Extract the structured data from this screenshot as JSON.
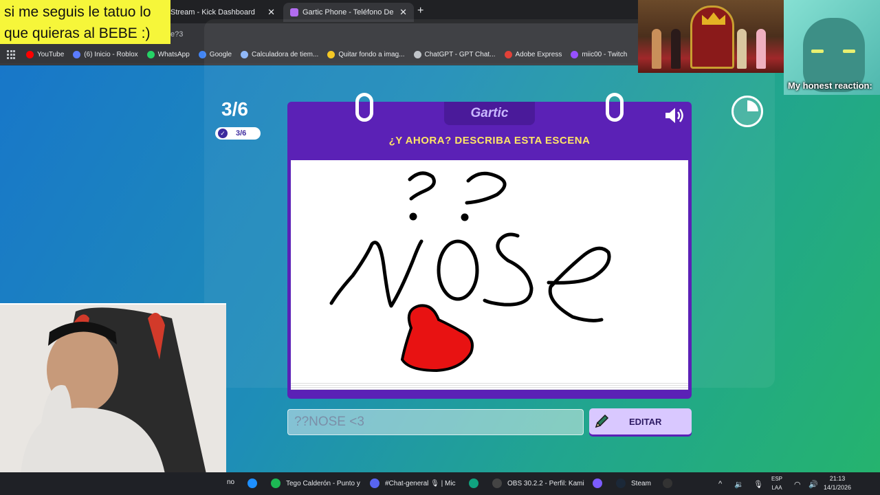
{
  "browser": {
    "tabs": [
      {
        "title": "Stream - Kick Dashboard",
        "active": false
      },
      {
        "title": "Gartic Phone - Teléfono Descon",
        "active": true
      }
    ],
    "address_fragment": "e?3",
    "bookmarks": [
      {
        "label": "YouTube",
        "icon": "youtube-icon",
        "color": "#ff0000"
      },
      {
        "label": "(6) Inicio - Roblox",
        "icon": "roblox-icon",
        "color": "#5b7cff"
      },
      {
        "label": "WhatsApp",
        "icon": "whatsapp-icon",
        "color": "#25d366"
      },
      {
        "label": "Google",
        "icon": "google-icon",
        "color": "#4285f4"
      },
      {
        "label": "Calculadora de tiem...",
        "icon": "calculator-icon",
        "color": "#8ab4f8"
      },
      {
        "label": "Quitar fondo a imag...",
        "icon": "image-icon",
        "color": "#f5c518"
      },
      {
        "label": "ChatGPT - GPT Chat...",
        "icon": "chatgpt-icon",
        "color": "#bdc1c6"
      },
      {
        "label": "Adobe Express",
        "icon": "adobe-icon",
        "color": "#e0362c"
      },
      {
        "label": "miic00 - Twitch",
        "icon": "twitch-icon",
        "color": "#9146ff"
      }
    ]
  },
  "game": {
    "round_big": "3/6",
    "round_pill": "3/6",
    "logo": "Gartic",
    "prompt": "¿Y AHORA? DESCRIBA ESTA ESCENA",
    "answer_value": "??NOSE <3",
    "edit_label": "EDITAR",
    "accent": "#5b21b6",
    "prompt_color": "#ffe566"
  },
  "overlays": {
    "caption": "si me seguis le tatuo lo que quieras al BEBE :)",
    "reaction": "My honest reaction:"
  },
  "taskbar": {
    "items": [
      {
        "label": "no",
        "icon": "window-icon"
      },
      {
        "label": "",
        "icon": "drop-icon"
      },
      {
        "label": "Tego Calderón - Punto y",
        "icon": "spotify-icon"
      },
      {
        "label": "#Chat-general 🎙 | Mic",
        "icon": "discord-icon"
      },
      {
        "label": "",
        "icon": "chatgpt-icon"
      },
      {
        "label": "OBS 30.2.2 - Perfil: Kami",
        "icon": "obs-icon"
      },
      {
        "label": "",
        "icon": "copilot-icon"
      },
      {
        "label": "Steam",
        "icon": "steam-icon"
      },
      {
        "label": "",
        "icon": "capcut-icon"
      }
    ],
    "lang_top": "ESP",
    "lang_bottom": "LAA",
    "time": "21:13",
    "date": "14/1/2026"
  }
}
